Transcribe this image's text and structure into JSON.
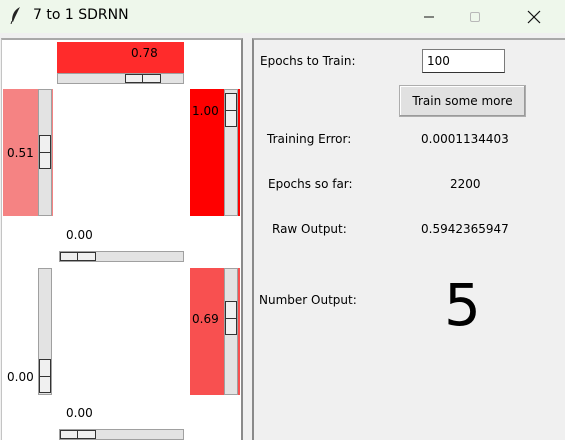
{
  "window": {
    "title": "7 to 1 SDRNN"
  },
  "scales": {
    "top": {
      "value_label": "0.78",
      "value": 0.78,
      "color": "#ff2b2b"
    },
    "left_upper": {
      "value_label": "0.51",
      "value": 0.51,
      "color": "#f58383"
    },
    "right_upper": {
      "value_label": "1.00",
      "value": 1.0,
      "color": "#ff0000"
    },
    "middle": {
      "value_label": "0.00",
      "value": 0.0
    },
    "left_lower": {
      "value_label": "0.00",
      "value": 0.0,
      "color": "#ffffff"
    },
    "right_lower": {
      "value_label": "0.69",
      "value": 0.69,
      "color": "#f85050"
    },
    "bottom": {
      "value_label": "0.00",
      "value": 0.0
    }
  },
  "controls": {
    "epochs_label": "Epochs to Train:",
    "epochs_value": "100",
    "train_button": "Train some more",
    "training_error_label": "Training Error:",
    "training_error_value": "0.0001134403",
    "epochs_so_far_label": "Epochs so far:",
    "epochs_so_far_value": "2200",
    "raw_output_label": "Raw Output:",
    "raw_output_value": "0.5942365947",
    "number_output_label": "Number Output:",
    "number_output_value": "5"
  },
  "icons": {
    "app": "feather-icon",
    "minimize": "minimize-icon",
    "maximize": "maximize-icon",
    "close": "close-icon"
  }
}
